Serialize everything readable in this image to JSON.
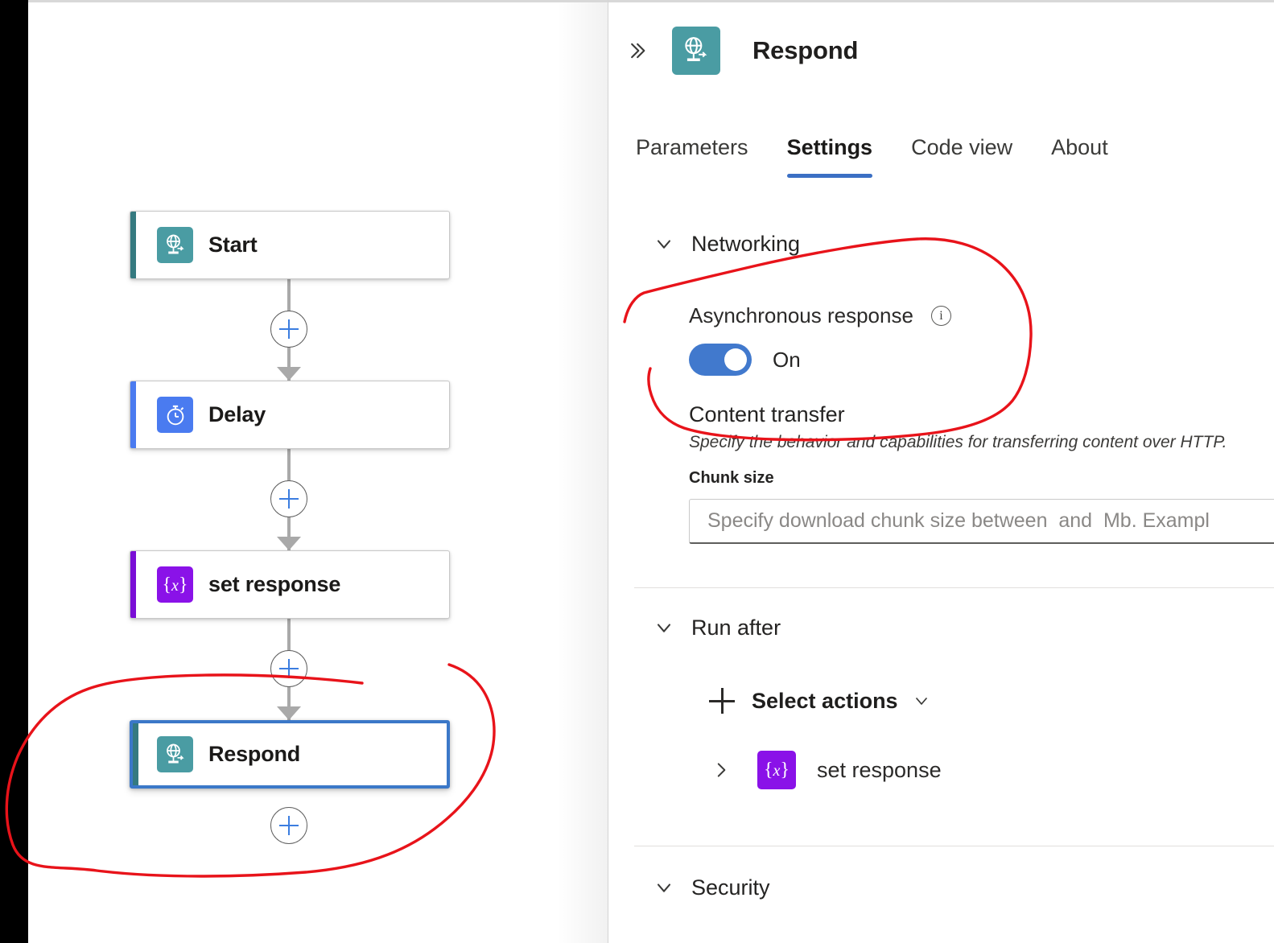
{
  "canvas": {
    "nodes": [
      {
        "label": "Start",
        "icon": "globe-arrow-icon",
        "icon_color": "#4a9ca3",
        "accent_color": "#357a80",
        "selected": false
      },
      {
        "label": "Delay",
        "icon": "stopwatch-icon",
        "icon_color": "#4a7bf0",
        "accent_color": "#4a7bf0",
        "selected": false
      },
      {
        "label": "set response",
        "icon": "variable-icon",
        "icon_color": "#8a12e8",
        "accent_color": "#7a0ed6",
        "selected": false
      },
      {
        "label": "Respond",
        "icon": "globe-arrow-icon",
        "icon_color": "#4a9ca3",
        "accent_color": "#357a80",
        "selected": true
      }
    ],
    "add_buttons": [
      {
        "name": "add-step-after-start"
      },
      {
        "name": "add-step-after-delay"
      },
      {
        "name": "add-step-after-set-response"
      },
      {
        "name": "add-step-after-respond"
      }
    ]
  },
  "panel": {
    "collapse_icon": "chevron-double-right-icon",
    "app_icon": "globe-arrow-icon",
    "title": "Respond",
    "tabs": [
      {
        "label": "Parameters",
        "active": false
      },
      {
        "label": "Settings",
        "active": true
      },
      {
        "label": "Code view",
        "active": false
      },
      {
        "label": "About",
        "active": false
      }
    ],
    "accent_color": "#3b6fc4",
    "networking": {
      "heading": "Networking",
      "expanded": true,
      "async_response": {
        "label": "Asynchronous response",
        "info_icon": "info-icon",
        "toggle_state": "On",
        "toggle_on": true,
        "toggle_color": "#4179cd"
      },
      "content_transfer": {
        "heading": "Content transfer",
        "description": "Specify the behavior and capabilities for transferring content over HTTP.",
        "chunk_size": {
          "label": "Chunk size",
          "value": "",
          "placeholder": "Specify download chunk size between  and  Mb. Exampl"
        }
      }
    },
    "run_after": {
      "heading": "Run after",
      "expanded": true,
      "select_actions": {
        "label": "Select actions",
        "plus_icon": "plus-icon",
        "chevron_icon": "chevron-down-icon"
      },
      "rows": [
        {
          "label": "set response",
          "icon": "variable-icon",
          "icon_color": "#8a12e8",
          "chevron_icon": "chevron-right-icon"
        }
      ]
    },
    "security": {
      "heading": "Security",
      "expanded": true
    }
  },
  "annotations": {
    "ink_color": "#e8131a",
    "marks": [
      {
        "name": "circle-around-asynchronous-response"
      },
      {
        "name": "circle-around-respond-node"
      }
    ]
  }
}
